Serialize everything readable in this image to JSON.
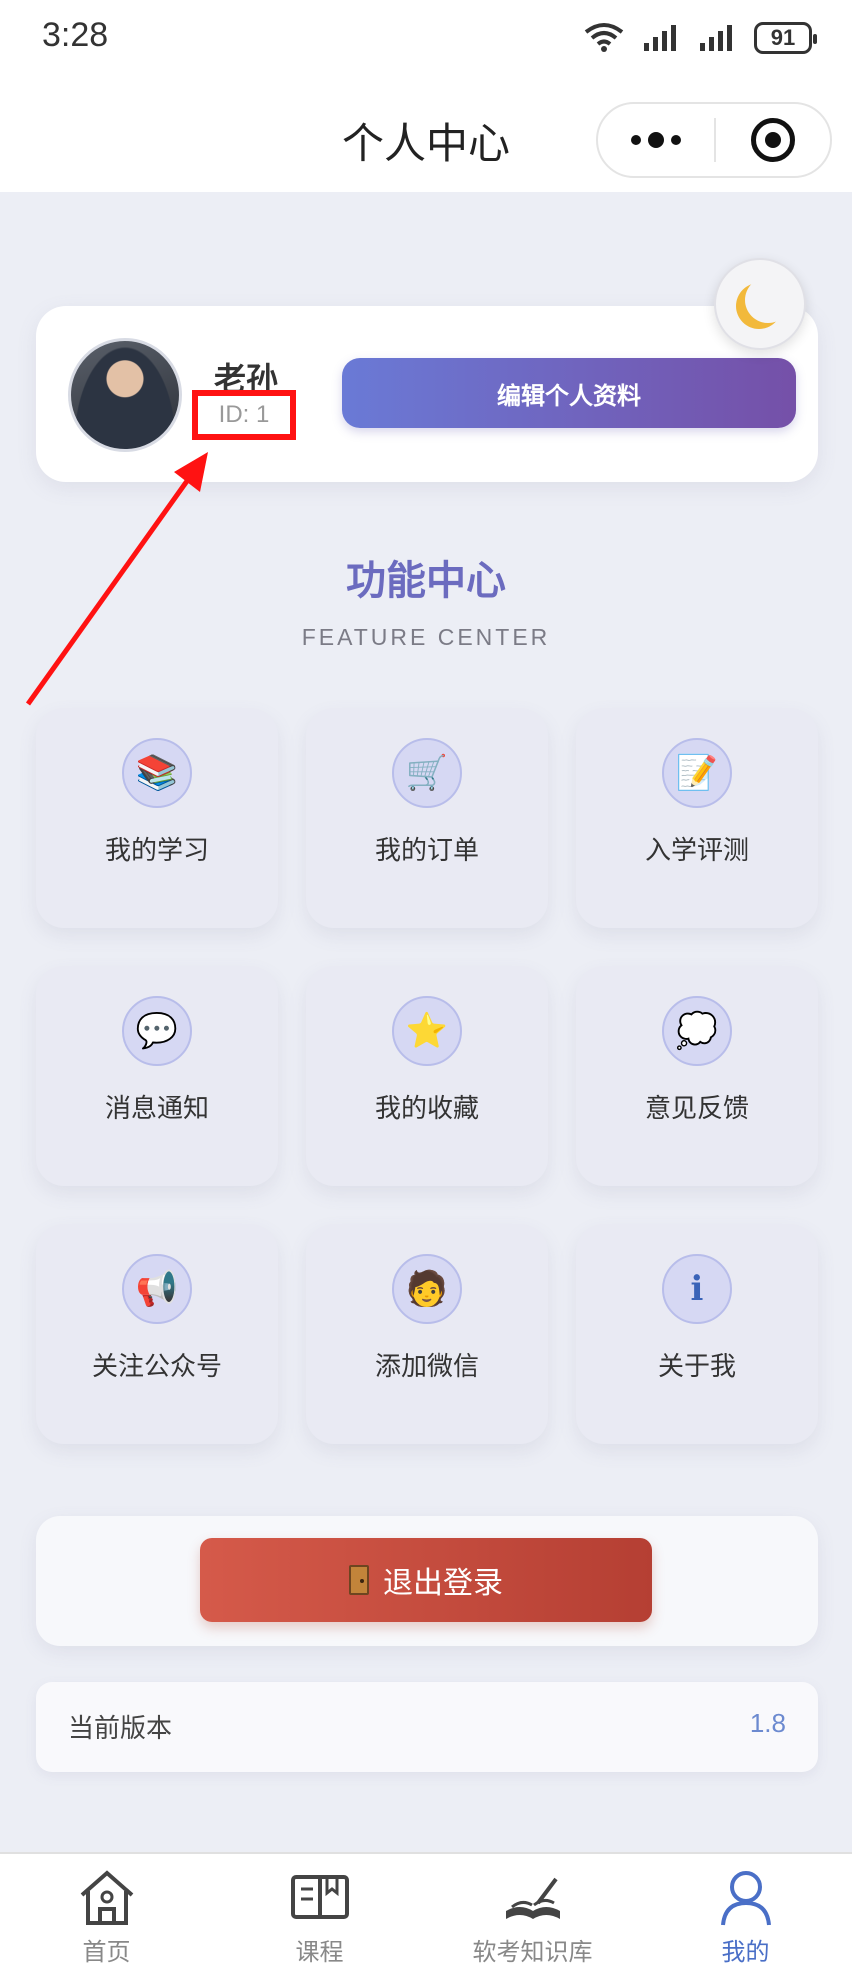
{
  "status_bar": {
    "time": "3:28",
    "battery": "91"
  },
  "nav": {
    "title": "个人中心"
  },
  "profile": {
    "name": "老孙",
    "id_text": "ID: 1",
    "edit_label": "编辑个人资料"
  },
  "features": {
    "title": "功能中心",
    "subtitle": "FEATURE CENTER",
    "items": [
      {
        "label": "我的学习",
        "icon": "books-icon",
        "glyph": "📚"
      },
      {
        "label": "我的订单",
        "icon": "cart-icon",
        "glyph": "🛒"
      },
      {
        "label": "入学评测",
        "icon": "memo-icon",
        "glyph": "📝"
      },
      {
        "label": "消息通知",
        "icon": "speech-bubble-icon",
        "glyph": "💬"
      },
      {
        "label": "我的收藏",
        "icon": "star-icon",
        "glyph": "⭐"
      },
      {
        "label": "意见反馈",
        "icon": "thought-bubble-icon",
        "glyph": "💭"
      },
      {
        "label": "关注公众号",
        "icon": "megaphone-icon",
        "glyph": "📢"
      },
      {
        "label": "添加微信",
        "icon": "technologist-icon",
        "glyph": "🧑"
      },
      {
        "label": "关于我",
        "icon": "info-icon",
        "glyph": "ℹ"
      }
    ]
  },
  "logout": {
    "label": "退出登录"
  },
  "version": {
    "label": "当前版本",
    "value": "1.8"
  },
  "tabs": [
    {
      "label": "首页",
      "icon": "home-icon"
    },
    {
      "label": "课程",
      "icon": "book-icon"
    },
    {
      "label": "软考知识库",
      "icon": "knowledge-book-icon"
    },
    {
      "label": "我的",
      "icon": "user-icon"
    }
  ],
  "colors": {
    "accent": "#4a6fc7",
    "annotation": "#ff1212",
    "logout": "#c94a3d"
  }
}
